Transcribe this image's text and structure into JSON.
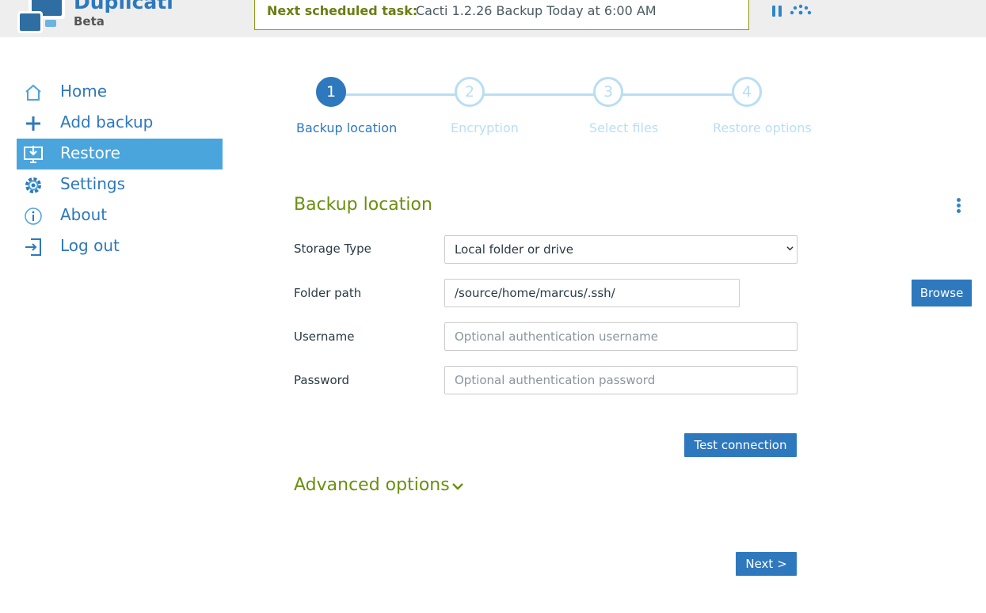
{
  "header": {
    "brand": "Duplicati",
    "subtitle": "Beta",
    "task_label": "Next scheduled task:",
    "task_value": "Cacti 1.2.26 Backup Today at 6:00 AM",
    "icons": [
      "pause-icon",
      "throttle-icon"
    ]
  },
  "sidebar": {
    "items": [
      {
        "label": "Home",
        "icon": "home-icon"
      },
      {
        "label": "Add backup",
        "icon": "plus-icon"
      },
      {
        "label": "Restore",
        "icon": "restore-icon",
        "active": true
      },
      {
        "label": "Settings",
        "icon": "gear-icon"
      },
      {
        "label": "About",
        "icon": "info-icon"
      },
      {
        "label": "Log out",
        "icon": "logout-icon"
      }
    ]
  },
  "stepper": {
    "steps": [
      {
        "number": "1",
        "label": "Backup location",
        "active": true
      },
      {
        "number": "2",
        "label": "Encryption"
      },
      {
        "number": "3",
        "label": "Select files"
      },
      {
        "number": "4",
        "label": "Restore options"
      }
    ]
  },
  "form": {
    "title": "Backup location",
    "storage_type": {
      "label": "Storage Type",
      "value": "Local folder or drive"
    },
    "folder_path": {
      "label": "Folder path",
      "value": "/source/home/marcus/.ssh/"
    },
    "username": {
      "label": "Username",
      "placeholder": "Optional authentication username"
    },
    "password": {
      "label": "Password",
      "placeholder": "Optional authentication password"
    },
    "browse_label": "Browse",
    "test_label": "Test connection",
    "advanced_label": "Advanced options",
    "next_label": "Next >"
  },
  "colors": {
    "accent": "#2e78bd",
    "active_nav": "#4aa5dc",
    "section_green": "#6a8f10",
    "inactive_step": "#b9def4"
  }
}
